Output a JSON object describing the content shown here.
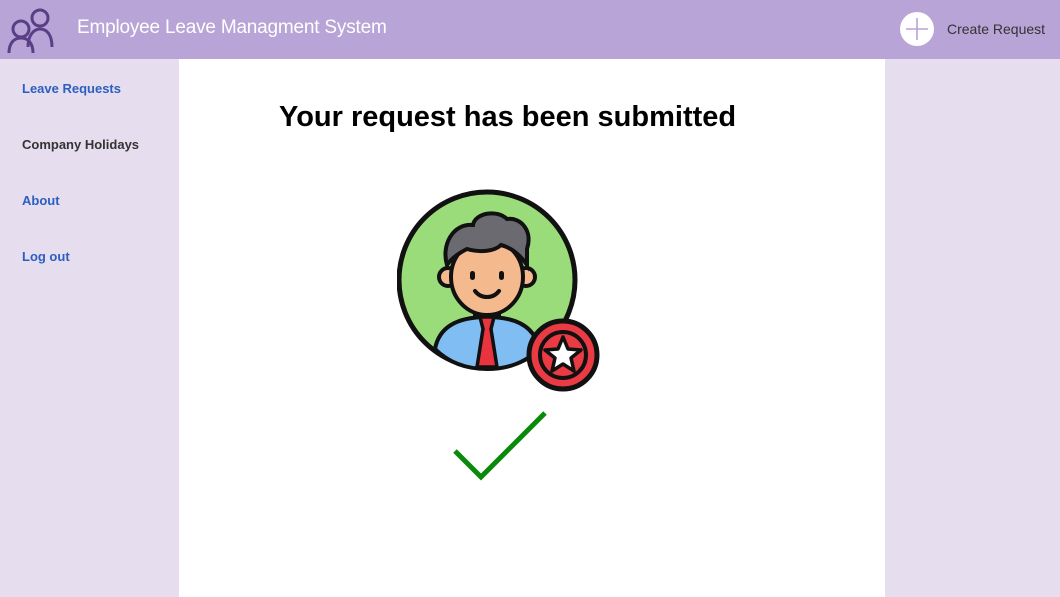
{
  "header": {
    "title": "Employee Leave Managment System",
    "create_request_label": "Create Request",
    "logo_icon": "users-icon",
    "plus_icon": "plus-icon"
  },
  "sidebar": {
    "items": [
      {
        "label": "Leave Requests"
      },
      {
        "label": "Company Holidays"
      },
      {
        "label": "About"
      },
      {
        "label": "Log out"
      }
    ]
  },
  "main": {
    "headline": "Your request has been submitted",
    "illustration_icon": "employee-star-icon",
    "success_icon": "checkmark-icon"
  },
  "colors": {
    "header_bg": "#b8a4d6",
    "sidebar_bg": "#e6ddef",
    "link": "#2c5fbf",
    "success": "#0a8a0a"
  }
}
